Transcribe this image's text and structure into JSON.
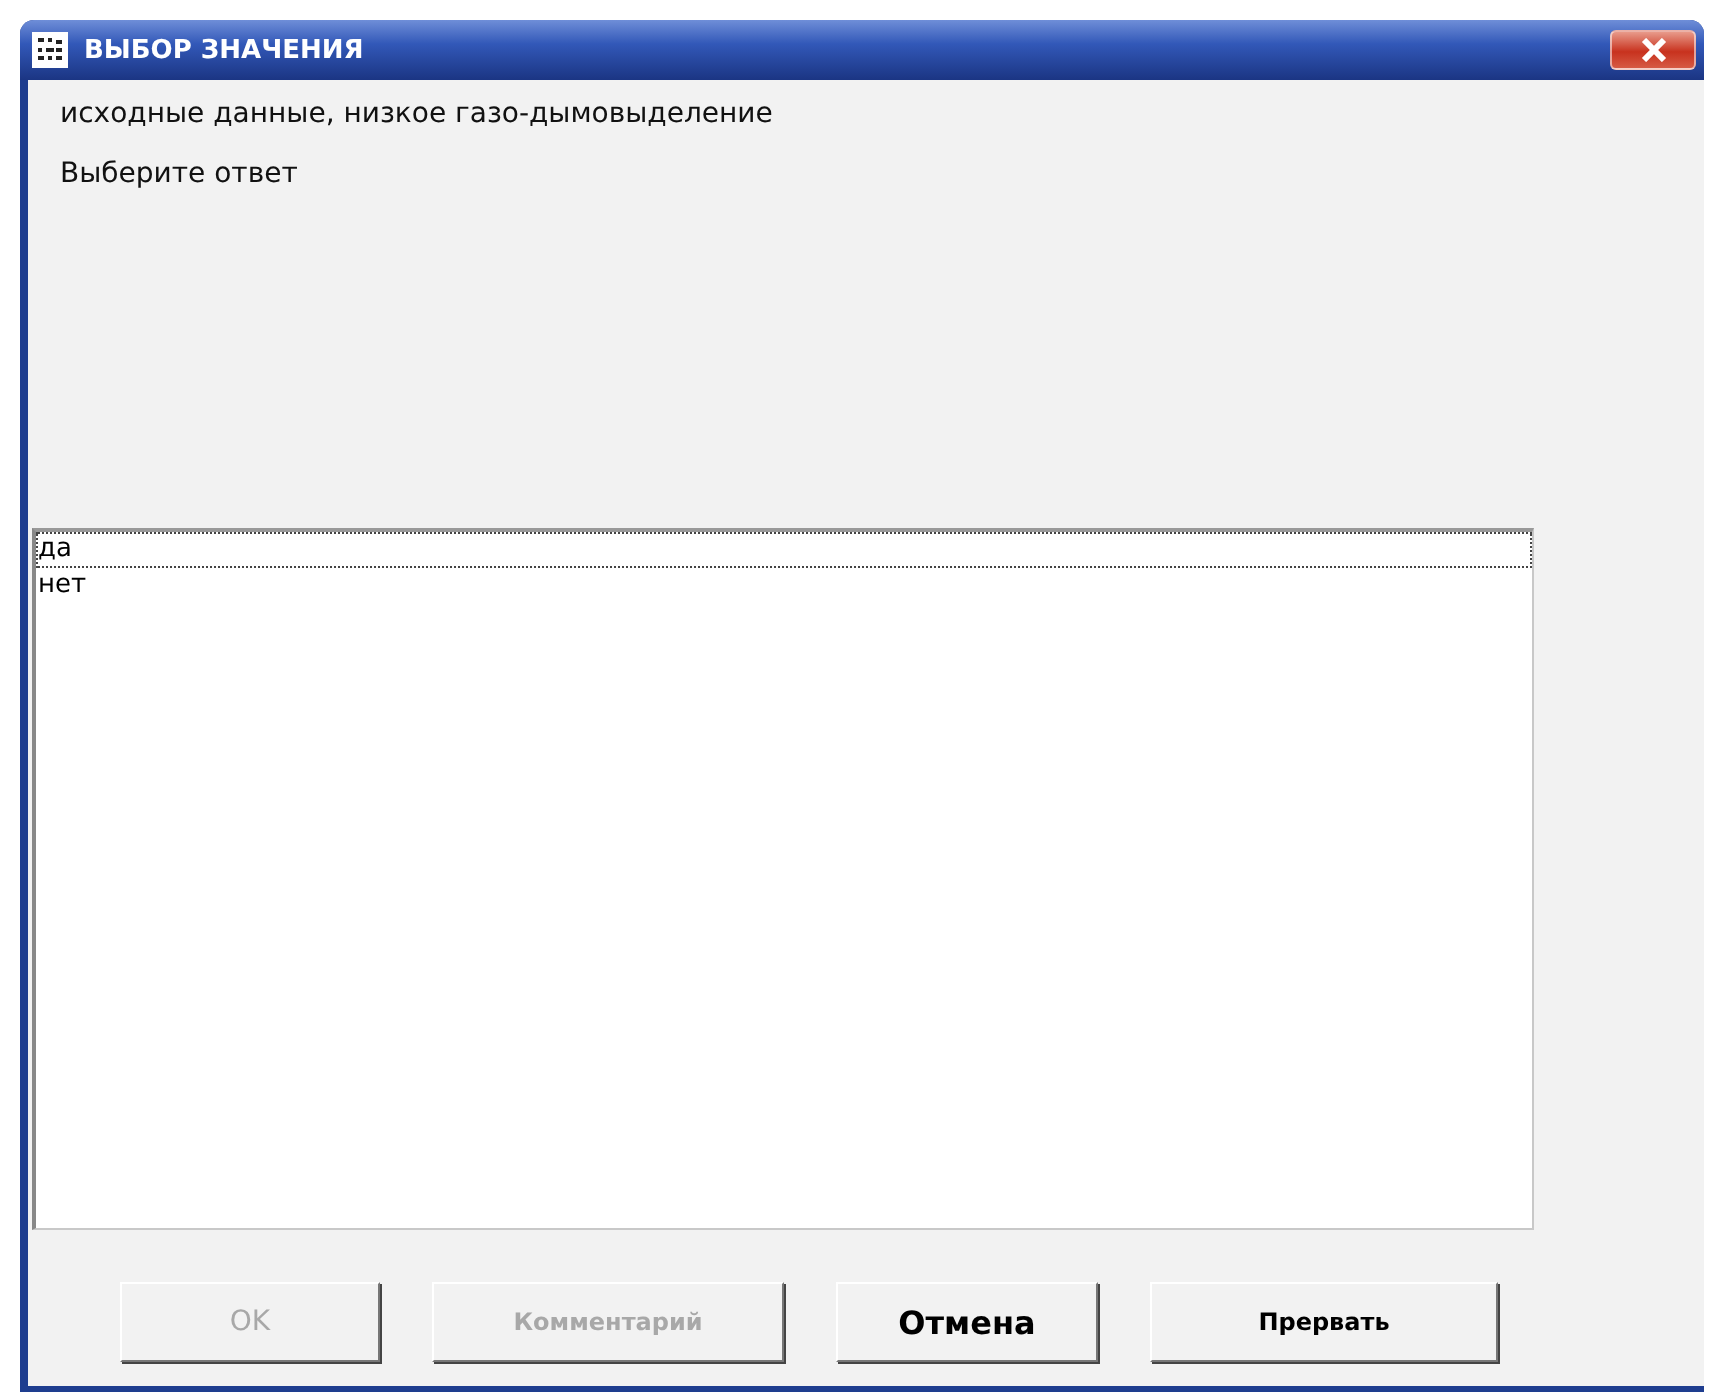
{
  "window": {
    "title": "ВЫБОР ЗНАЧЕНИЯ"
  },
  "prompt_lines": [
    "исходные данные, низкое газо-дымовыделение",
    "Выберите ответ"
  ],
  "options": [
    {
      "label": "да",
      "focused": true
    },
    {
      "label": "нет",
      "focused": false
    }
  ],
  "buttons": [
    {
      "label": "OK",
      "disabled": true
    },
    {
      "label": "Комментарий",
      "disabled": true
    },
    {
      "label": "Отмена",
      "disabled": false
    },
    {
      "label": "Прервать",
      "disabled": false
    }
  ]
}
